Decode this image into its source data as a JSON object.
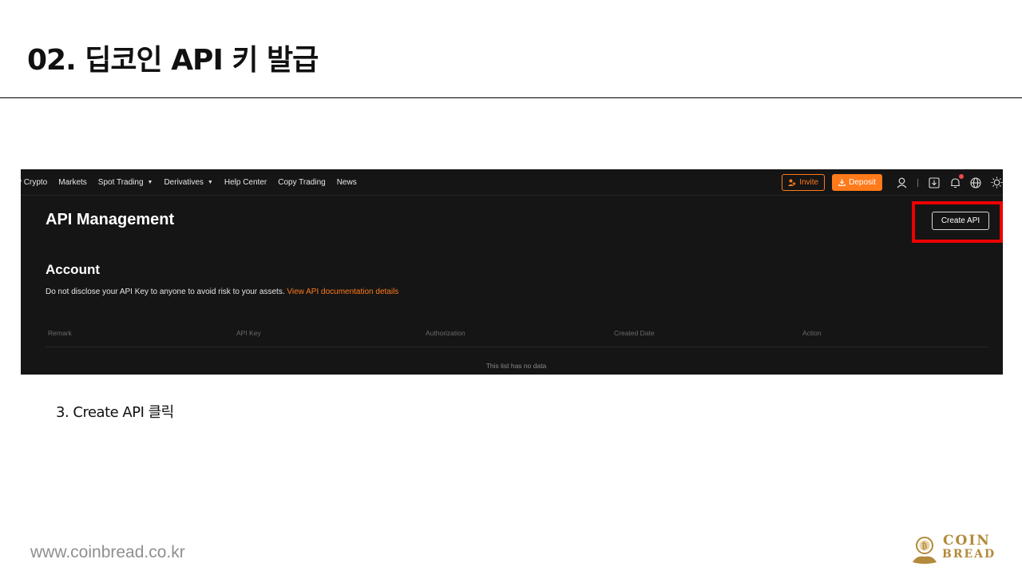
{
  "slide": {
    "title": "02. 딥코인 API 키 발급",
    "caption": "3. Create API 클릭",
    "url": "www.coinbread.co.kr",
    "logo": {
      "line1": "COIN",
      "line2": "BREAD",
      "color": "#b38a3b"
    }
  },
  "nav": {
    "items": [
      {
        "label": "y Crypto"
      },
      {
        "label": "Markets"
      },
      {
        "label": "Spot Trading",
        "dropdown": true
      },
      {
        "label": "Derivatives",
        "dropdown": true
      },
      {
        "label": "Help Center"
      },
      {
        "label": "Copy Trading"
      },
      {
        "label": "News"
      }
    ],
    "invite_label": "Invite",
    "deposit_label": "Deposit",
    "icons": [
      "user-icon",
      "download-icon",
      "bell-icon",
      "globe-icon",
      "theme-icon"
    ],
    "accent": "#ff7a1a"
  },
  "main": {
    "heading": "API Management",
    "create_label": "Create API",
    "section_heading": "Account",
    "warning_text": "Do not disclose your API Key to anyone to avoid risk to your assets.",
    "doc_link": "View API documentation details",
    "columns": [
      "Remark",
      "API Key",
      "Authorization",
      "Created Date",
      "Action"
    ],
    "empty_text": "This list has no data"
  },
  "highlight_color": "#ee0000"
}
